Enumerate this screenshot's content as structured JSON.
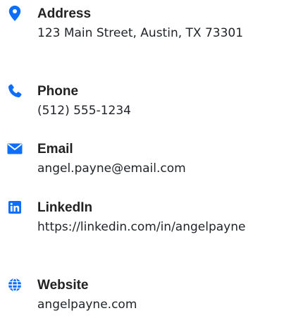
{
  "accent_color": "#0d6efd",
  "contacts": [
    {
      "icon": "map-marker-icon",
      "label": "Address",
      "value": "123 Main Street, Austin, TX 73301"
    },
    {
      "icon": "phone-icon",
      "label": "Phone",
      "value": "(512) 555-1234"
    },
    {
      "icon": "envelope-icon",
      "label": "Email",
      "value": "angel.payne@email.com"
    },
    {
      "icon": "linkedin-icon",
      "label": "LinkedIn",
      "value": "https://linkedin.com/in/angelpayne"
    },
    {
      "icon": "globe-icon",
      "label": "Website",
      "value": "angelpayne.com"
    }
  ]
}
